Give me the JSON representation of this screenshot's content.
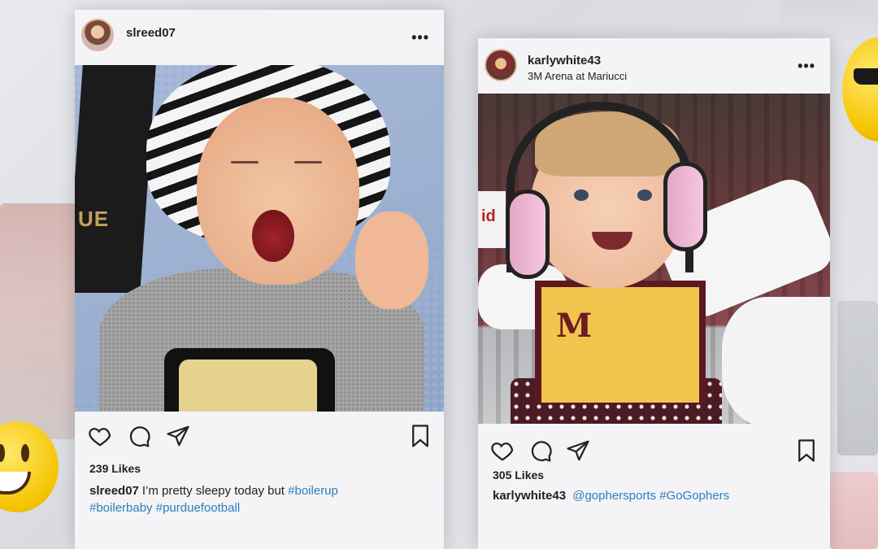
{
  "posts": [
    {
      "username": "slreed07",
      "likes": "239 Likes",
      "caption_user": "slreed07",
      "caption_text": "I’m pretty sleepy today but ",
      "caption_tag1": "#boilerup",
      "caption_tag2": "#boilerbaby",
      "caption_tag3": "#purduefootball",
      "jersey_text": "UE"
    },
    {
      "username": "karlywhite43",
      "location": "3M Arena at Mariucci",
      "likes": "305 Likes",
      "caption_user": "karlywhite43",
      "caption_tag1": "@gophersports",
      "caption_tag2": "#GoGophers",
      "shirt_logo": "M",
      "board_text": "id"
    }
  ],
  "icons": [
    "more-icon",
    "heart-icon",
    "comment-icon",
    "share-icon",
    "bookmark-icon"
  ],
  "colors": {
    "hashtag": "#2a7fbe",
    "card": "#f4f4f6"
  }
}
